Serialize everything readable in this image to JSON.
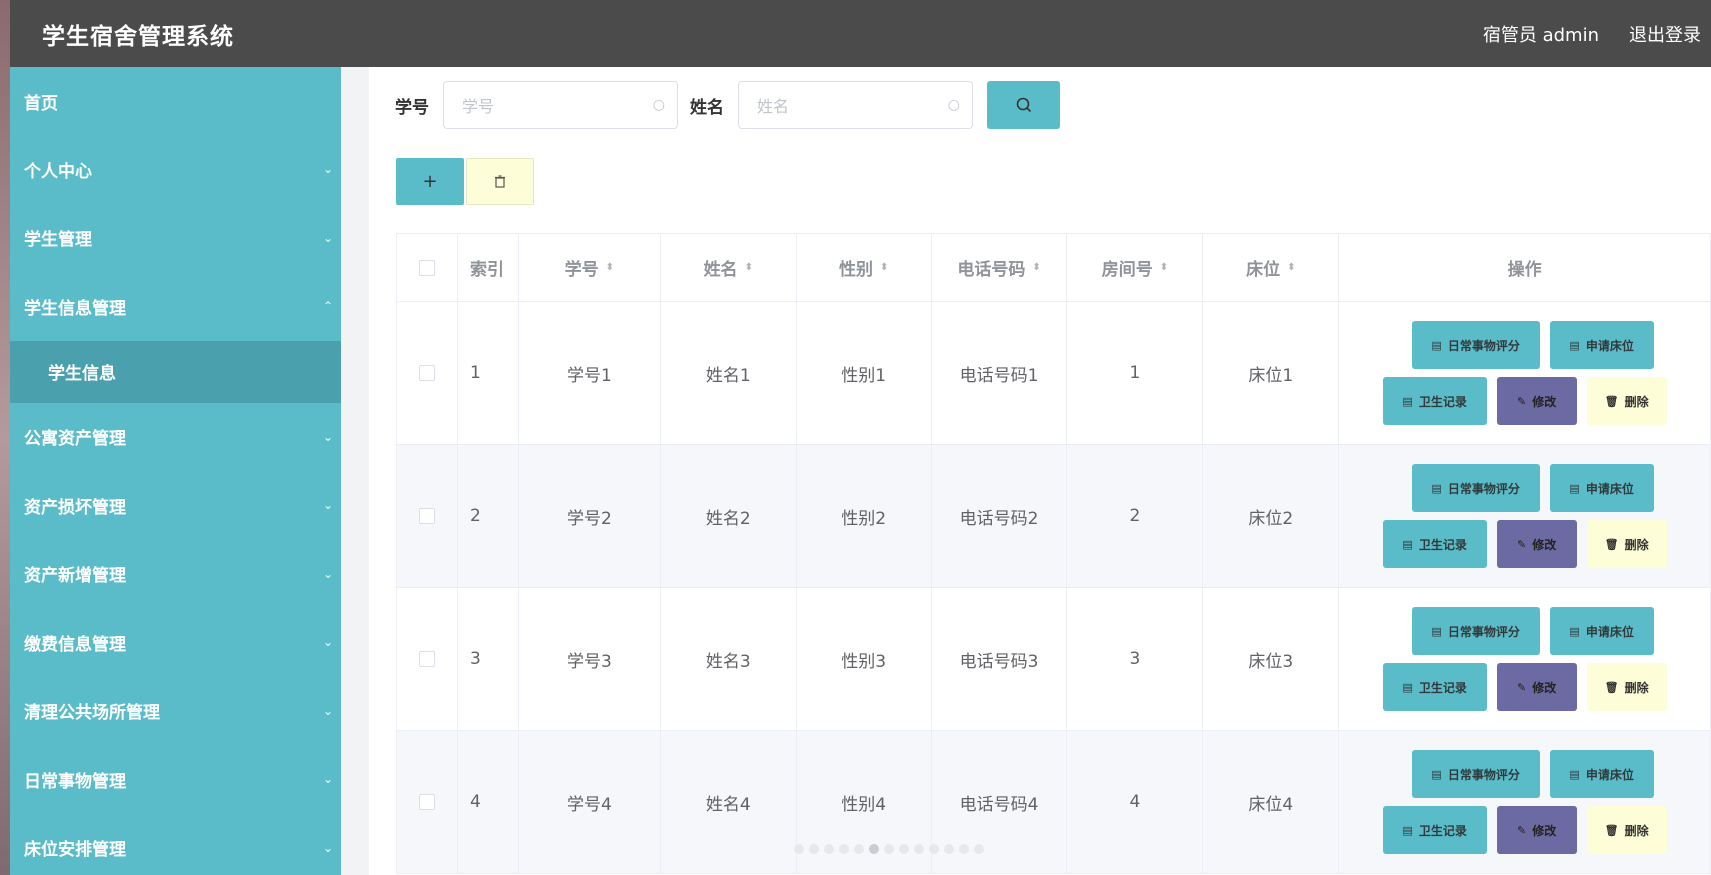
{
  "header": {
    "title": "学生宿舍管理系统",
    "user": "宿管员 admin",
    "logout": "退出登录"
  },
  "sidebar": {
    "items": [
      {
        "label": "首页",
        "chevron": ""
      },
      {
        "label": "个人中心",
        "chevron": "⌄"
      },
      {
        "label": "学生管理",
        "chevron": "⌄"
      },
      {
        "label": "学生信息管理",
        "chevron": "⌃"
      },
      {
        "label": "学生信息",
        "chevron": ""
      },
      {
        "label": "公寓资产管理",
        "chevron": "⌄"
      },
      {
        "label": "资产损坏管理",
        "chevron": "⌄"
      },
      {
        "label": "资产新增管理",
        "chevron": "⌄"
      },
      {
        "label": "缴费信息管理",
        "chevron": "⌄"
      },
      {
        "label": "清理公共场所管理",
        "chevron": "⌄"
      },
      {
        "label": "日常事物管理",
        "chevron": "⌄"
      },
      {
        "label": "床位安排管理",
        "chevron": "⌄"
      }
    ]
  },
  "search": {
    "sid_label": "学号",
    "sid_placeholder": "学号",
    "name_label": "姓名",
    "name_placeholder": "姓名",
    "search_icon": "search-icon",
    "search_glyph": "⌕"
  },
  "actions": {
    "add": "+",
    "delete": "🗑"
  },
  "table": {
    "headers": [
      "索引",
      "学号",
      "姓名",
      "性别",
      "电话号码",
      "房间号",
      "床位",
      "操作"
    ],
    "sort_glyph": "⬍",
    "rows": [
      {
        "index": "1",
        "sid": "学号1",
        "name": "姓名1",
        "sex": "性别1",
        "tel": "电话号码1",
        "room": "1",
        "bed": "床位1"
      },
      {
        "index": "2",
        "sid": "学号2",
        "name": "姓名2",
        "sex": "性别2",
        "tel": "电话号码2",
        "room": "2",
        "bed": "床位2"
      },
      {
        "index": "3",
        "sid": "学号3",
        "name": "姓名3",
        "sex": "性别3",
        "tel": "电话号码3",
        "room": "3",
        "bed": "床位3"
      },
      {
        "index": "4",
        "sid": "学号4",
        "name": "姓名4",
        "sex": "性别4",
        "tel": "电话号码4",
        "room": "4",
        "bed": "床位4"
      }
    ],
    "ops": {
      "score": "日常事物评分",
      "apply": "申请床位",
      "hygiene": "卫生记录",
      "edit": "修改",
      "delete": "删除"
    }
  },
  "colors": {
    "header": "#4b4b4b",
    "sidebar": "#5bbcc9",
    "sidebar_active": "#4aa0ad",
    "teal_button": "#5bbcc9",
    "purple_button": "#6c6aa2",
    "yellow_button": "#fdfdd7"
  }
}
